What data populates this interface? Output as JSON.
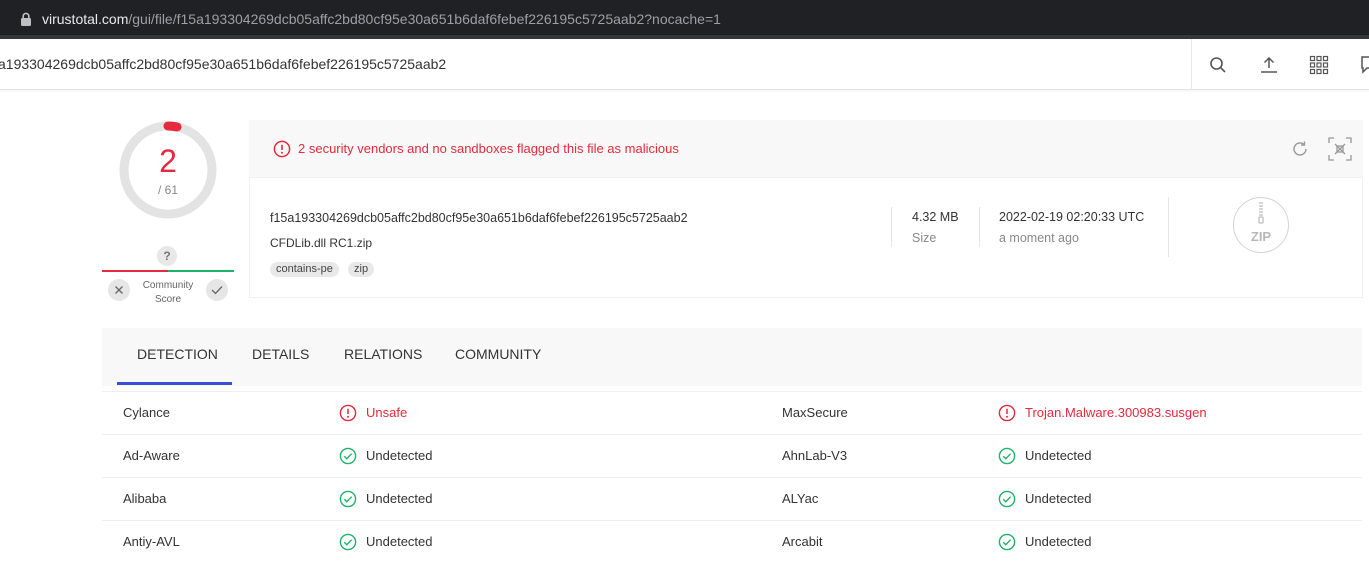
{
  "browser": {
    "url_host": "virustotal.com",
    "url_path": "/gui/file/f15a193304269dcb05affc2bd80cf95e30a651b6daf6febef226195c5725aab2?nocache=1"
  },
  "header": {
    "search_value": "a193304269dcb05affc2bd80cf95e30a651b6daf6febef226195c5725aab2",
    "icons": [
      "search-icon",
      "upload-icon",
      "apps-grid-icon",
      "chat-icon"
    ]
  },
  "score": {
    "detections": "2",
    "total": "/ 61",
    "community_unknown": "?",
    "community_label_line1": "Community",
    "community_label_line2": "Score",
    "fraction_flagged": 0.0328
  },
  "alert": {
    "message": "2 security vendors and no sandboxes flagged this file as malicious"
  },
  "file": {
    "hash": "f15a193304269dcb05affc2bd80cf95e30a651b6daf6febef226195c5725aab2",
    "name": "CFDLib.dll RC1.zip",
    "tags": [
      "contains-pe",
      "zip"
    ],
    "size_value": "4.32 MB",
    "size_label": "Size",
    "date_value": "2022-02-19 02:20:33 UTC",
    "date_ago": "a moment ago",
    "type_badge": "ZIP"
  },
  "tabs": [
    "DETECTION",
    "DETAILS",
    "RELATIONS",
    "COMMUNITY"
  ],
  "detections": [
    {
      "vendor_left": "Cylance",
      "result_left": "Unsafe",
      "left_flagged": true,
      "vendor_right": "MaxSecure",
      "result_right": "Trojan.Malware.300983.susgen",
      "right_flagged": true
    },
    {
      "vendor_left": "Ad-Aware",
      "result_left": "Undetected",
      "left_flagged": false,
      "vendor_right": "AhnLab-V3",
      "result_right": "Undetected",
      "right_flagged": false
    },
    {
      "vendor_left": "Alibaba",
      "result_left": "Undetected",
      "left_flagged": false,
      "vendor_right": "ALYac",
      "result_right": "Undetected",
      "right_flagged": false
    },
    {
      "vendor_left": "Antiy-AVL",
      "result_left": "Undetected",
      "left_flagged": false,
      "vendor_right": "Arcabit",
      "result_right": "Undetected",
      "right_flagged": false
    }
  ],
  "colors": {
    "malicious": "#e6293d",
    "clean": "#1fb36a",
    "accent": "#3a4fd9"
  }
}
